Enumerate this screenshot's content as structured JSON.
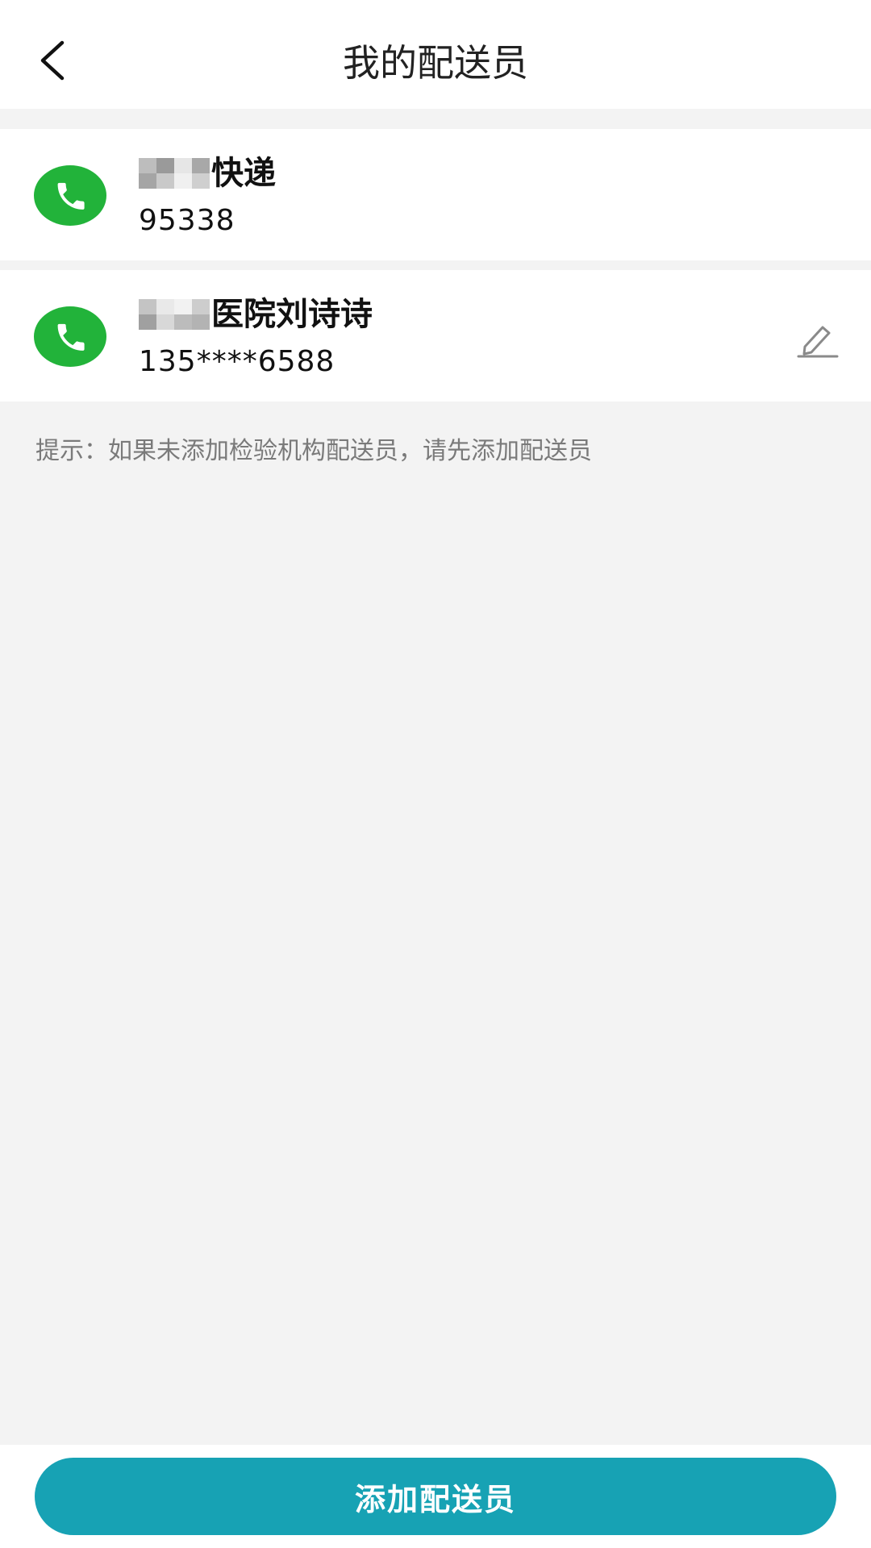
{
  "header": {
    "title": "我的配送员"
  },
  "couriers": [
    {
      "name_suffix": "快递",
      "phone": "95338"
    },
    {
      "name_suffix": "医院刘诗诗",
      "phone": "135****6588"
    }
  ],
  "hint": "提示：如果未添加检验机构配送员，请先添加配送员",
  "bottom": {
    "add_label": "添加配送员"
  },
  "colors": {
    "call_green": "#22b33a",
    "accent_teal": "#17a2b4",
    "page_bg": "#f3f3f3"
  },
  "icons": {
    "back": "chevron-left-icon",
    "call": "phone-icon",
    "edit": "pencil-icon"
  }
}
